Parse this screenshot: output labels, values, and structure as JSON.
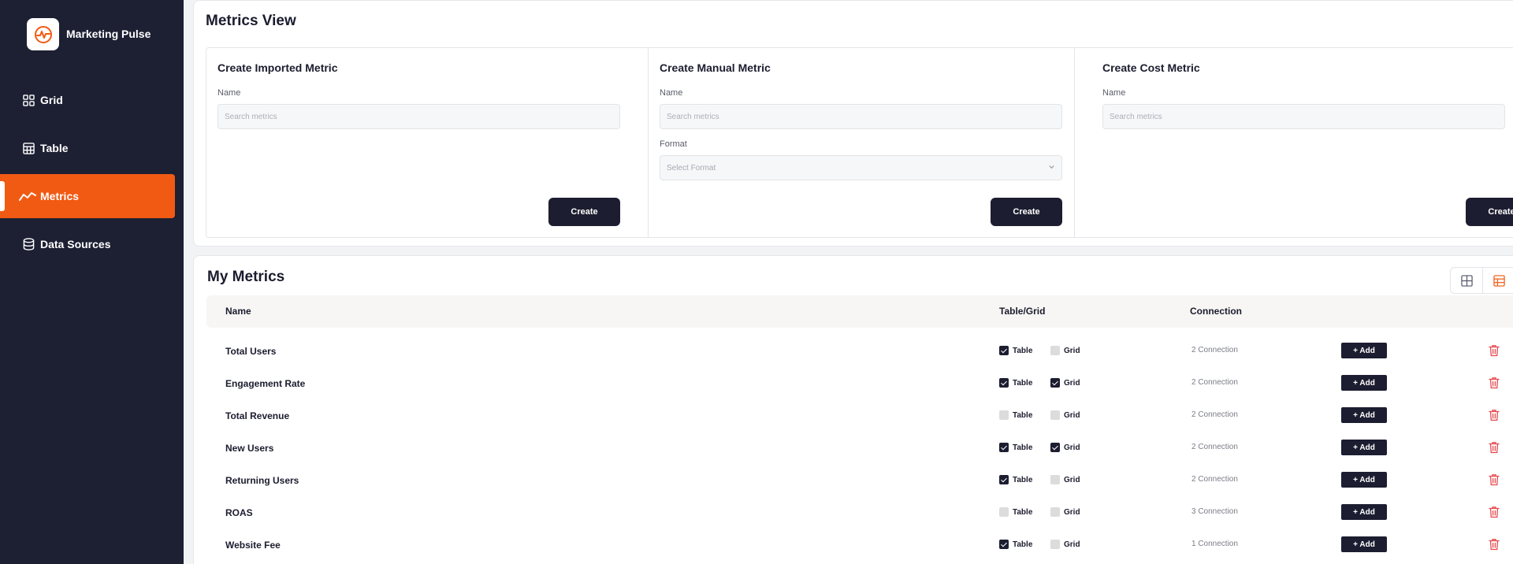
{
  "app": {
    "name": "Marketing Pulse"
  },
  "icons": {
    "logo": "pulse-logo-icon",
    "grid": "grid-icon",
    "table": "table-icon",
    "metrics": "trend-line-icon",
    "data_sources": "database-icon",
    "trash": "trash-icon",
    "chevron": "chevron-down-icon"
  },
  "colors": {
    "accent": "#f15a13",
    "sidebar": "#1d1f33",
    "button": "#1c1d30",
    "danger": "#e5484d"
  },
  "sidebar": {
    "items": [
      {
        "label": "Grid",
        "icon": "grid-icon",
        "active": false
      },
      {
        "label": "Table",
        "icon": "table-icon",
        "active": false
      },
      {
        "label": "Metrics",
        "icon": "trend-line-icon",
        "active": true
      },
      {
        "label": "Data Sources",
        "icon": "database-icon",
        "active": false
      }
    ]
  },
  "page": {
    "title": "Metrics View"
  },
  "forms": {
    "imported": {
      "title": "Create Imported Metric",
      "name_label": "Name",
      "name_placeholder": "Search metrics",
      "button": "Create"
    },
    "manual": {
      "title": "Create Manual Metric",
      "name_label": "Name",
      "name_placeholder": "Search metrics",
      "format_label": "Format",
      "format_value": "Select Format",
      "button": "Create"
    },
    "cost": {
      "title": "Create Cost Metric",
      "name_label": "Name",
      "name_placeholder": "Search metrics",
      "button": "Create"
    }
  },
  "my_metrics": {
    "title": "My Metrics",
    "view_mode": "table",
    "columns": {
      "name": "Name",
      "table_grid": "Table/Grid",
      "connection": "Connection"
    },
    "table_label": "Table",
    "grid_label": "Grid",
    "add_label": "+ Add",
    "rows": [
      {
        "name": "Total Users",
        "table": true,
        "grid": false,
        "connection": "2 Connection"
      },
      {
        "name": "Engagement Rate",
        "table": true,
        "grid": true,
        "connection": "2 Connection"
      },
      {
        "name": "Total Revenue",
        "table": false,
        "grid": false,
        "connection": "2 Connection"
      },
      {
        "name": "New Users",
        "table": true,
        "grid": true,
        "connection": "2 Connection"
      },
      {
        "name": "Returning Users",
        "table": true,
        "grid": false,
        "connection": "2 Connection"
      },
      {
        "name": "ROAS",
        "table": false,
        "grid": false,
        "connection": "3 Connection"
      },
      {
        "name": "Website Fee",
        "table": true,
        "grid": false,
        "connection": "1 Connection"
      }
    ]
  }
}
